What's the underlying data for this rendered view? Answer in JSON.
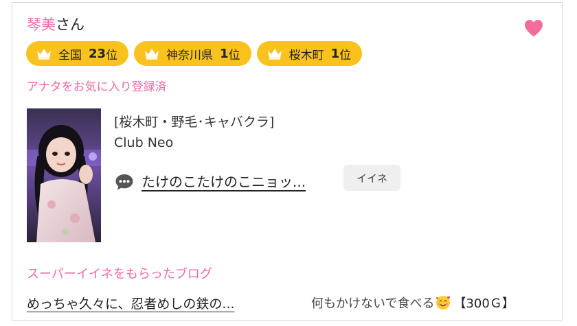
{
  "profile": {
    "name": "琴美",
    "suffix": "さん",
    "favorite_status": "アナタをお気に入り登録済"
  },
  "badges": [
    {
      "label": "全国",
      "rank": "23",
      "unit": "位"
    },
    {
      "label": "神奈川県",
      "rank": "1",
      "unit": "位"
    },
    {
      "label": "桜木町",
      "rank": "1",
      "unit": "位"
    }
  ],
  "shop": {
    "category": "[桜木町・野毛･キャバクラ]",
    "name": "Club Neo"
  },
  "latest_blog": {
    "title": "たけのこたけのこニョッ...",
    "iine_label": "イイネ"
  },
  "super_iine_section": {
    "title": "スーパーイイネをもらったブログ",
    "blog_title": "めっちゃ久々に、忍者めしの鉄の...",
    "comment": "何もかけないで食べる",
    "emoji": "smiling-face-with-hearts-icon",
    "price": "【300Ｇ】"
  },
  "colors": {
    "accent_pink": "#f06aa8",
    "badge_yellow": "#f9c21e",
    "heart_pink": "#f26d9b"
  }
}
